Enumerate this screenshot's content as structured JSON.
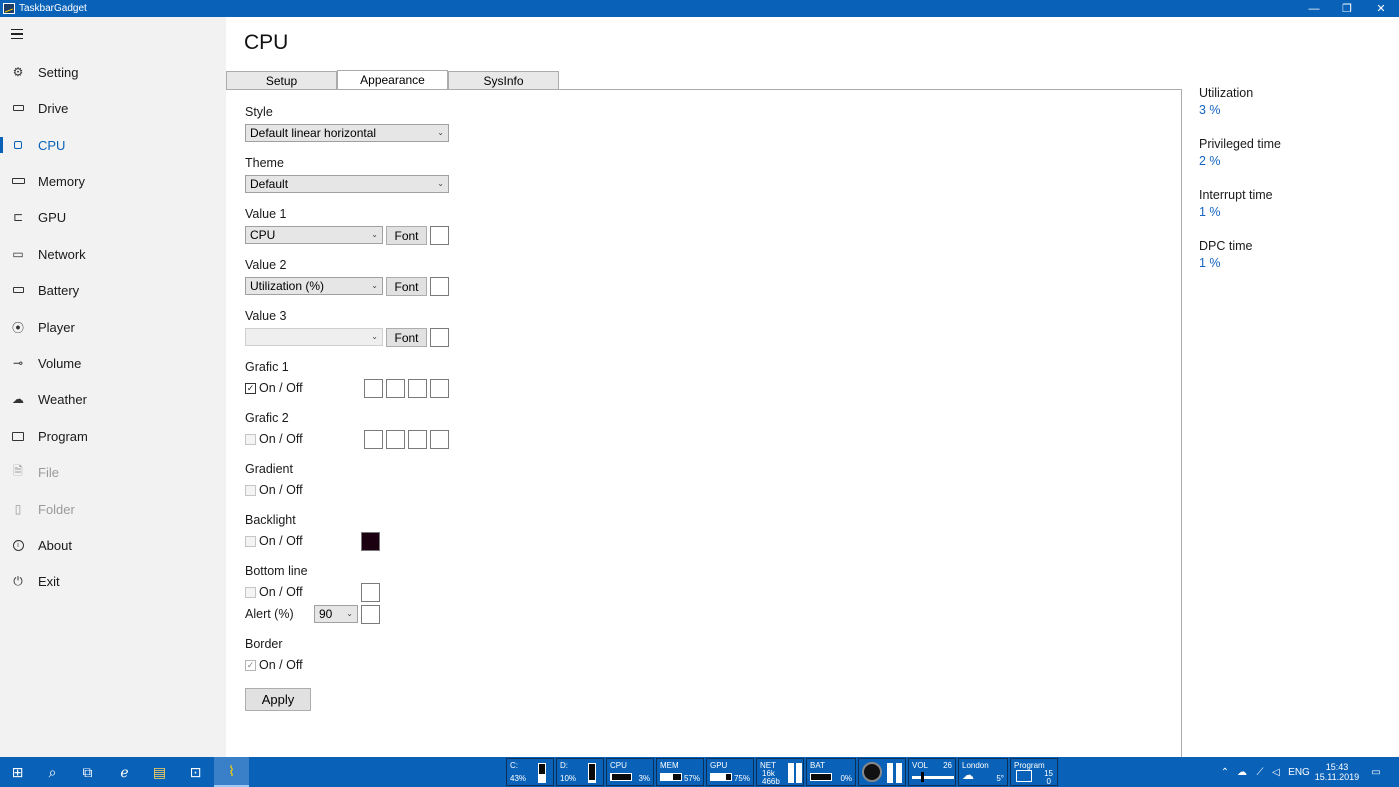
{
  "window": {
    "title": "TaskbarGadget",
    "minimize": "—",
    "restore": "❐",
    "close": "✕"
  },
  "sidebar": {
    "items": [
      {
        "label": "Setting",
        "icon": "gear-icon"
      },
      {
        "label": "Drive",
        "icon": "drive-icon"
      },
      {
        "label": "CPU",
        "icon": "cpu-icon"
      },
      {
        "label": "Memory",
        "icon": "memory-icon"
      },
      {
        "label": "GPU",
        "icon": "gpu-icon"
      },
      {
        "label": "Network",
        "icon": "network-icon"
      },
      {
        "label": "Battery",
        "icon": "battery-icon"
      },
      {
        "label": "Player",
        "icon": "player-icon"
      },
      {
        "label": "Volume",
        "icon": "volume-icon"
      },
      {
        "label": "Weather",
        "icon": "weather-icon"
      },
      {
        "label": "Program",
        "icon": "program-icon"
      },
      {
        "label": "File",
        "icon": "file-icon"
      },
      {
        "label": "Folder",
        "icon": "folder-icon"
      },
      {
        "label": "About",
        "icon": "info-icon"
      },
      {
        "label": "Exit",
        "icon": "power-icon"
      }
    ],
    "active": "CPU"
  },
  "main": {
    "title": "CPU",
    "tabs": [
      "Setup",
      "Appearance",
      "SysInfo"
    ],
    "active_tab": "Appearance",
    "form": {
      "style_label": "Style",
      "style_value": "Default linear horizontal",
      "theme_label": "Theme",
      "theme_value": "Default",
      "value1_label": "Value 1",
      "value1_value": "CPU",
      "value2_label": "Value 2",
      "value2_value": "Utilization (%)",
      "value3_label": "Value 3",
      "value3_value": "",
      "font_button": "Font",
      "grafic1_label": "Grafic 1",
      "grafic2_label": "Grafic 2",
      "gradient_label": "Gradient",
      "backlight_label": "Backlight",
      "bottomline_label": "Bottom line",
      "alert_label": "Alert (%)",
      "alert_value": "90",
      "border_label": "Border",
      "onoff_label": "On / Off",
      "apply_button": "Apply",
      "backlight_color": "#1a0010"
    }
  },
  "sysinfo": [
    {
      "label": "Utilization",
      "value": "3 %"
    },
    {
      "label": "Privileged time",
      "value": "2 %"
    },
    {
      "label": "Interrupt time",
      "value": "1 %"
    },
    {
      "label": "DPC time",
      "value": "1 %"
    }
  ],
  "taskbar": {
    "gadgets": {
      "c_label": "C:",
      "c_value": "43%",
      "d_label": "D:",
      "d_value": "10%",
      "cpu_label": "CPU",
      "cpu_value": "3%",
      "mem_label": "MEM",
      "mem_value": "57%",
      "gpu_label": "GPU",
      "gpu_value": "75%",
      "net_label": "NET",
      "net_up": "16k",
      "net_down": "466b",
      "bat_label": "BAT",
      "bat_value": "0%",
      "vol_label": "VOL",
      "vol_value": "26",
      "weather_city": "London",
      "weather_temp": "5°",
      "program_label": "Program",
      "program_v1": "15",
      "program_v2": "0"
    },
    "tray": {
      "lang": "ENG",
      "time": "15:43",
      "date": "15.11.2019"
    }
  }
}
